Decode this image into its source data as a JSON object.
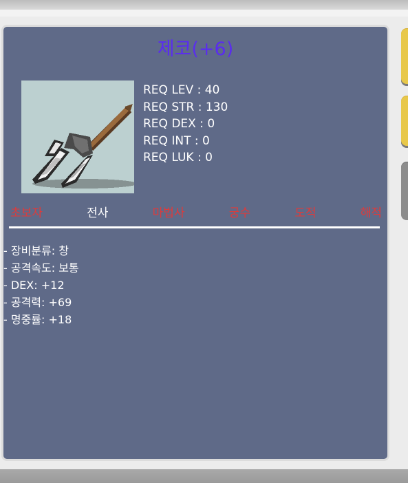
{
  "item": {
    "name": "제코(+6)"
  },
  "requirements": [
    "REQ LEV : 40",
    "REQ STR : 130",
    "REQ DEX : 0",
    "REQ INT : 0",
    "REQ LUK : 0"
  ],
  "jobs": [
    {
      "label": "초보자",
      "allowed": false
    },
    {
      "label": "전사",
      "allowed": true
    },
    {
      "label": "마법사",
      "allowed": false
    },
    {
      "label": "궁수",
      "allowed": false
    },
    {
      "label": "도적",
      "allowed": false
    },
    {
      "label": "해적",
      "allowed": false
    }
  ],
  "stats": [
    "- 장비분류: 창",
    "- 공격속도: 보통",
    "- DEX: +12",
    "- 공격력: +69",
    "- 명중률: +18"
  ],
  "colors": {
    "panel": "#5f6a88",
    "title": "#5a2cf0",
    "job_allowed": "#ffffff",
    "job_disallowed": "#e03a3a",
    "side_yellow": "#e8c84a",
    "side_gray": "#8c8c8c"
  },
  "icons": {
    "item": "spear-icon"
  }
}
